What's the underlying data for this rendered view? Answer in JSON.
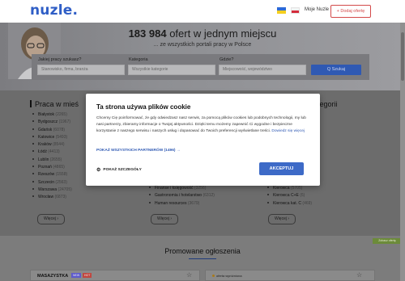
{
  "header": {
    "logo": "nuzle.",
    "moje_label": "Moje Nuzle",
    "post_job_label": "+ Dodaj ofertę"
  },
  "hero": {
    "count": "183 984",
    "title_rest": "ofert w jednym miejscu",
    "subtitle": "... ze wszystkich portali pracy w Polsce",
    "job_label": "Jakiej pracy szukasz?",
    "job_placeholder": "Stanowisko, firma, branża",
    "category_label": "Kategoria",
    "category_value": "Wszystkie kategorie",
    "location_label": "Gdzie?",
    "location_placeholder": "Miejscowość, województwo",
    "search_button": "Q Szukaj"
  },
  "sections": {
    "cities_title": "Praca w mieś",
    "cities": [
      {
        "name": "Białystok",
        "count": "(2265)"
      },
      {
        "name": "Bydgoszcz",
        "count": "(1967)"
      },
      {
        "name": "Gdańsk",
        "count": "(6078)"
      },
      {
        "name": "Katowice",
        "count": "(5493)"
      },
      {
        "name": "Kraków",
        "count": "(8544)"
      },
      {
        "name": "Łódź",
        "count": "(4413)"
      },
      {
        "name": "Lublin",
        "count": "(2655)"
      },
      {
        "name": "Poznań",
        "count": "(4865)"
      },
      {
        "name": "Rzeszów",
        "count": "(1558)"
      },
      {
        "name": "Szczecin",
        "count": "(2563)"
      },
      {
        "name": "Warszawa",
        "count": "(24705)"
      },
      {
        "name": "Wrocław",
        "count": "(6873)"
      }
    ],
    "col2_title": "",
    "col2_items": [
      {
        "name": "Finanse i księgowość",
        "count": "(3256)"
      },
      {
        "name": "Gastronomia i hotelarstwo",
        "count": "(6312)"
      },
      {
        "name": "Human resources",
        "count": "(3679)"
      }
    ],
    "col3_title": "Prawo jazdy kategorii",
    "col3_items": [
      {
        "name": "Kierowca",
        "count": "(5705)"
      },
      {
        "name": "Kierowca C+E",
        "count": "(6)"
      },
      {
        "name": "Kierowca kat. C",
        "count": "(469)"
      }
    ],
    "more_label": "Więcej ›"
  },
  "promo": {
    "title": "Promowane ogłoszenia",
    "company": "MASAZYSTKA",
    "tag_a": "NEW",
    "tag_b": "HOT",
    "pill": "oferta wyróżniona",
    "badge": "Zobacz ofertę"
  },
  "cookie_modal": {
    "title": "Ta strona używa plików cookie",
    "body": "Chcemy Cię poinformować, że gdy odwiedzasz nasz serwis, za pomocą plików cookies lub podobnych technologii, my lub nasi partnerzy, zbieramy informacje o Twojej aktywności. Dzięki temu możemy zapewnić Ci wygodne i bezpieczne korzystanie z naszego serwisu i naszych usług i dopasować do Twoich preferencji wyświetlane treści.",
    "link": "Dowiedz się więcej",
    "partners": "POKAŻ WSZYSTKICH PARTNERÓW (1496) →",
    "details": "POKAŻ SZCZEGÓŁY",
    "accept": "AKCEPTUJ"
  },
  "colors": {
    "brand": "#2f5ec6",
    "accept": "#3d6ac7",
    "danger": "#d34a4a"
  }
}
